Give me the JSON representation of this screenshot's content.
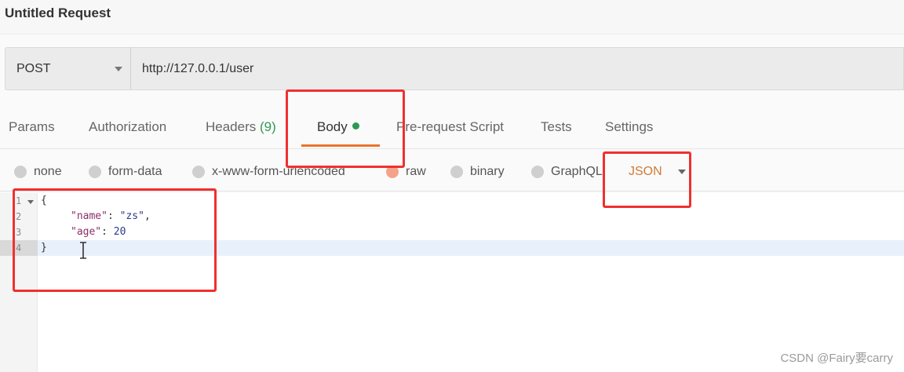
{
  "request": {
    "title": "Untitled Request",
    "method": "POST",
    "url": "http://127.0.0.1/user"
  },
  "tabs": [
    {
      "label": "Params"
    },
    {
      "label": "Authorization"
    },
    {
      "label": "Headers",
      "count": "(9)"
    },
    {
      "label": "Body",
      "active": true
    },
    {
      "label": "Pre-request Script"
    },
    {
      "label": "Tests"
    },
    {
      "label": "Settings"
    }
  ],
  "body_types": [
    {
      "label": "none"
    },
    {
      "label": "form-data"
    },
    {
      "label": "x-www-form-urlencoded"
    },
    {
      "label": "raw",
      "selected": true
    },
    {
      "label": "binary"
    },
    {
      "label": "GraphQL"
    }
  ],
  "language": "JSON",
  "editor": {
    "line_numbers": [
      "1",
      "2",
      "3",
      "4"
    ],
    "lines": {
      "l1": "{",
      "l2_key": "\"name\"",
      "l2_sep": ": ",
      "l2_val": "\"zs\"",
      "l2_end": ",",
      "l3_key": "\"age\"",
      "l3_sep": ": ",
      "l3_val": "20",
      "l4": "}"
    }
  },
  "icons": {
    "method_dropdown": "chevron-down-icon",
    "language_dropdown": "chevron-down-icon",
    "fold": "fold-arrow-icon",
    "text_cursor": "text-cursor-icon"
  },
  "colors": {
    "accent": "#e8742a",
    "status_green": "#2d9a54",
    "annotation_red": "#f03030"
  },
  "watermark": "CSDN @Fairy要carry"
}
